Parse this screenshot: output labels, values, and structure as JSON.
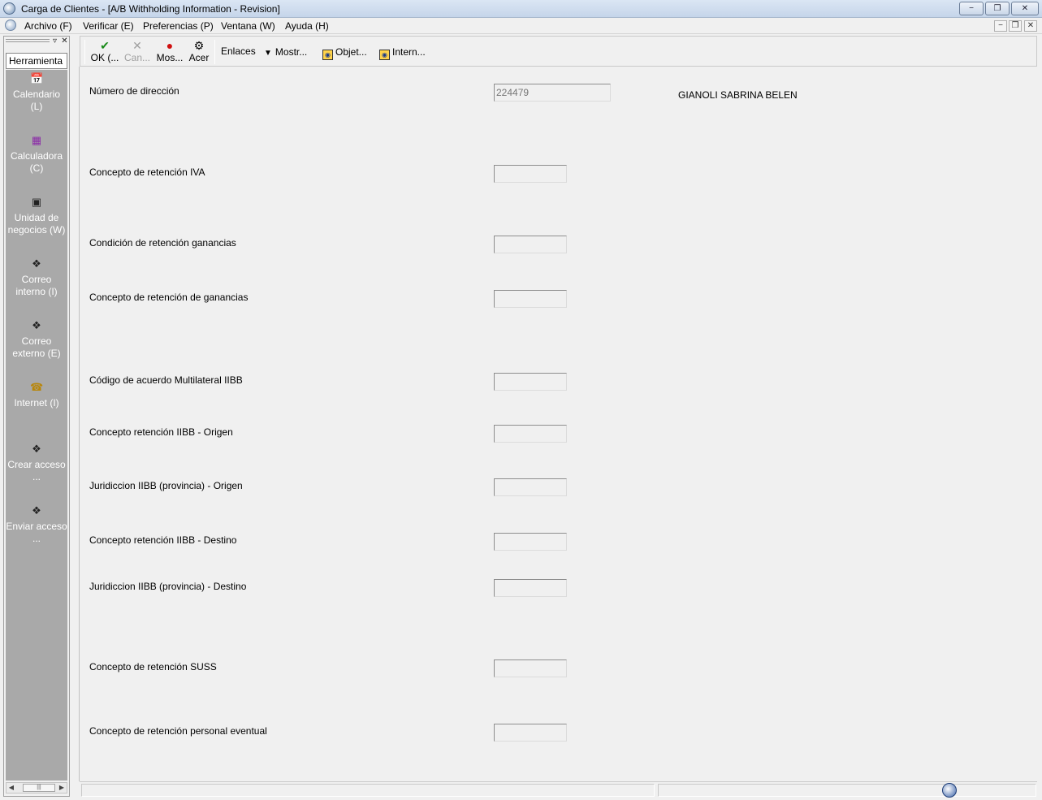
{
  "window": {
    "title": "Carga de Clientes - [A/B Withholding Information - Revision]",
    "minimize_icon": "minimize-icon",
    "restore_icon": "restore-icon",
    "close_icon": "close-icon"
  },
  "menu": {
    "items": [
      "Archivo (F)",
      "Verificar (E)",
      "Preferencias (P)",
      "Ventana (W)",
      "Ayuda (H)"
    ]
  },
  "sidebar": {
    "title": "Herramienta",
    "tools": [
      {
        "label": "Calendario (L)",
        "icon": "calendar-icon"
      },
      {
        "label": "Calculadora (C)",
        "icon": "calculator-icon"
      },
      {
        "label": "Unidad de negocios (W)",
        "icon": "business-unit-icon"
      },
      {
        "label": "Correo interno (I)",
        "icon": "mail-icon"
      },
      {
        "label": "Correo externo (E)",
        "icon": "mail-icon"
      },
      {
        "label": "Internet (I)",
        "icon": "phone-icon"
      },
      {
        "label": "Crear acceso ...",
        "icon": "shortcut-icon"
      },
      {
        "label": "Enviar acceso ...",
        "icon": "shortcut-icon"
      }
    ]
  },
  "toolbar": {
    "ok_label": "OK (...",
    "cancel_label": "Can...",
    "show_label": "Mos...",
    "about_label": "Acer",
    "links_label": "Enlaces",
    "display_label": "Mostr...",
    "objects_label": "Objet...",
    "internet_label": "Intern..."
  },
  "form": {
    "address_number_label": "Número de dirección",
    "address_number_value": "224479",
    "customer_name": "GIANOLI SABRINA BELEN",
    "fields": [
      {
        "label": "Concepto de retención IVA",
        "value": ""
      },
      {
        "label": "Condición de retención ganancias",
        "value": ""
      },
      {
        "label": "Concepto de retención de ganancias",
        "value": ""
      },
      {
        "label": "Código de acuerdo Multilateral IIBB",
        "value": ""
      },
      {
        "label": "Concepto retención IIBB - Origen",
        "value": ""
      },
      {
        "label": "Juridiccion IIBB (provincia) - Origen",
        "value": ""
      },
      {
        "label": "Concepto retención IIBB - Destino",
        "value": ""
      },
      {
        "label": "Juridiccion IIBB (provincia) - Destino",
        "value": ""
      },
      {
        "label": "Concepto de retención SUSS",
        "value": ""
      },
      {
        "label": "Concepto de retención personal eventual",
        "value": ""
      }
    ]
  }
}
